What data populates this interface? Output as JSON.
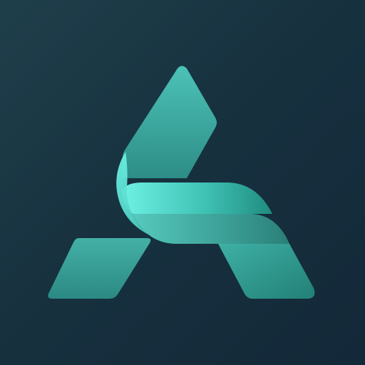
{
  "app_icon": {
    "icon": "stylized-letter-a-logo-icon",
    "colors": {
      "background_light": "#1f3f4b",
      "background_dark": "#132838",
      "teal_light": "#5fe8dc",
      "teal_mid": "#3fb3a7",
      "teal_dark": "#2c857f",
      "teal_deep": "#1e6e68"
    }
  }
}
